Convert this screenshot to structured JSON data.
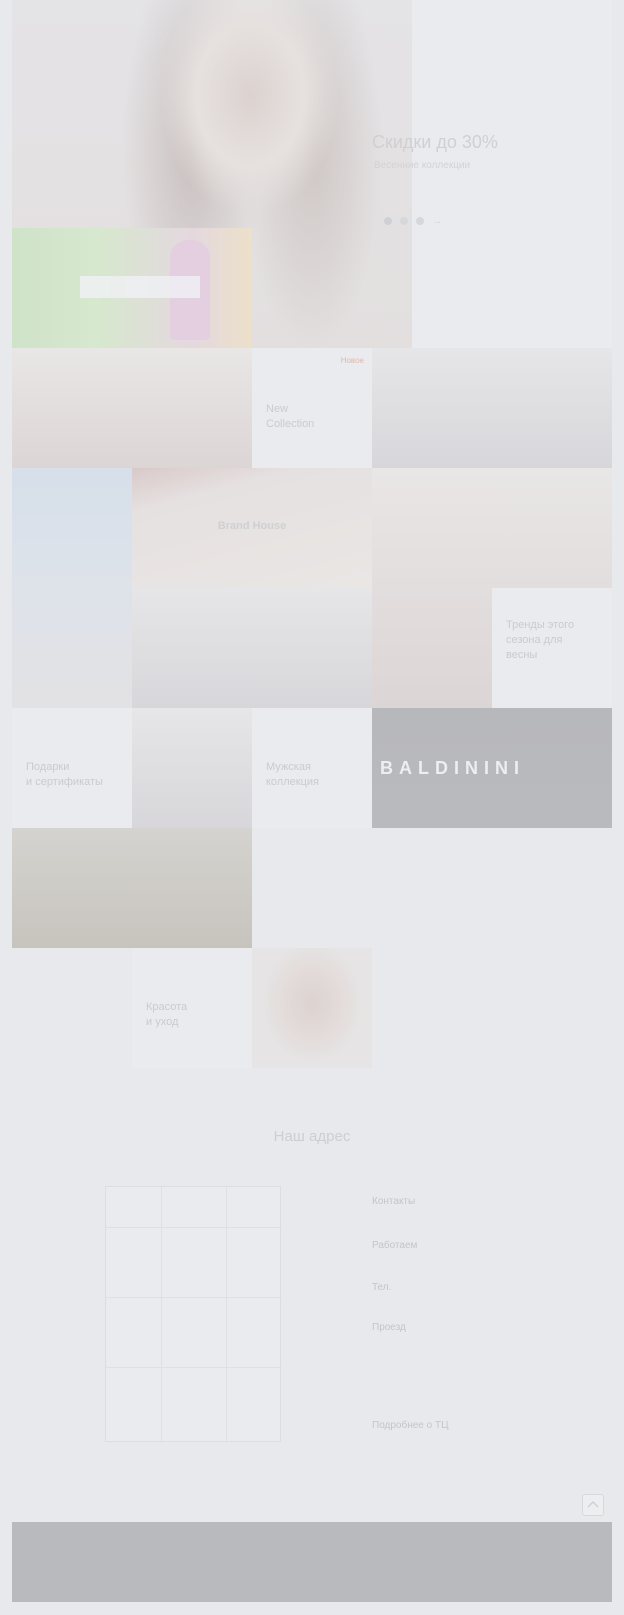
{
  "hero": {
    "title": "Скидки до 30%",
    "subtitle": "Весенние коллекции",
    "pagination_next": "→"
  },
  "tiles": {
    "new_collection": {
      "line1": "New",
      "line2": "Collection",
      "badge": "Новое",
      "meta": ""
    },
    "brand_banner": {
      "title": "Brand House",
      "subtitle": ""
    },
    "trends": {
      "line1": "Тренды этого",
      "line2": "сезона для",
      "line3": "весны",
      "badge": ""
    },
    "gift_cert": {
      "line1": "Подарки",
      "line2": "и сертификаты",
      "badge": ""
    },
    "sale_men": {
      "line1": "Мужская",
      "line2": "коллекция",
      "badge": ""
    },
    "brand_dark": {
      "name": "BALDININI"
    },
    "food_caption": "",
    "beauty": {
      "line1": "Красота",
      "line2": "и уход",
      "badge": ""
    }
  },
  "contacts": {
    "title": "Наш адрес",
    "address_label": "Контакты",
    "address_value": "",
    "hours_label": "Работаем",
    "hours_value": "",
    "phone_label": "Тел.",
    "phone_value": "",
    "transport_label": "Проезд",
    "transport_items": [
      "",
      "",
      "",
      "",
      ""
    ],
    "parking_label": "Подробнее о ТЦ",
    "parking_value": ""
  },
  "footer": {
    "copyright": "",
    "links": [
      "",
      "",
      "",
      "",
      "",
      ""
    ],
    "social": [
      "",
      ""
    ],
    "cta": ""
  },
  "icons": {
    "scroll_top": "chevron-up-icon"
  }
}
